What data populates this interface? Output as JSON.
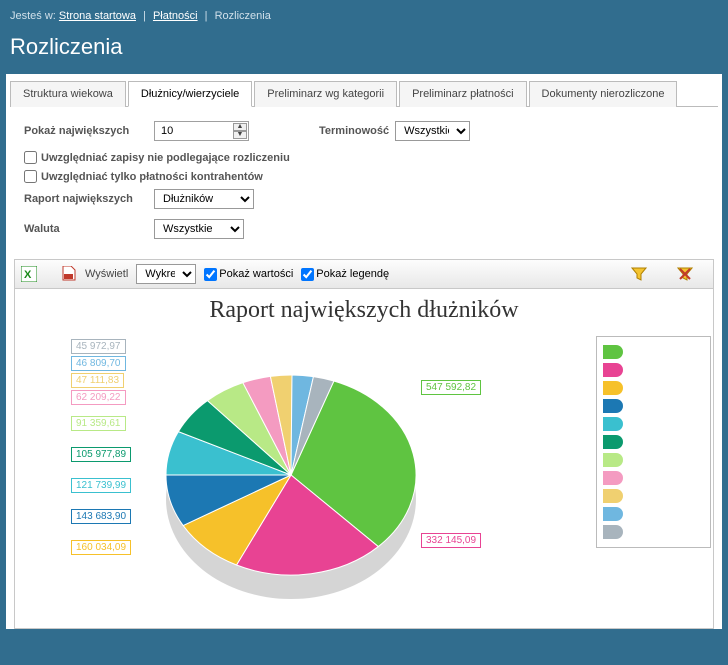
{
  "breadcrumb": {
    "prefix": "Jesteś w:",
    "items": [
      "Strona startowa",
      "Płatności",
      "Rozliczenia"
    ]
  },
  "page_title": "Rozliczenia",
  "tabs": [
    {
      "label": "Struktura wiekowa",
      "active": false
    },
    {
      "label": "Dłużnicy/wierzyciele",
      "active": true
    },
    {
      "label": "Preliminarz wg kategorii",
      "active": false
    },
    {
      "label": "Preliminarz płatności",
      "active": false
    },
    {
      "label": "Dokumenty nierozliczone",
      "active": false
    }
  ],
  "filters": {
    "pokaz_label": "Pokaż największych",
    "pokaz_value": "10",
    "terminowosc_label": "Terminowość",
    "terminowosc_value": "Wszystkie",
    "chk1_label": "Uwzględniać zapisy nie podlegające rozliczeniu",
    "chk1_checked": false,
    "chk2_label": "Uwzględniać tylko płatności kontrahentów",
    "chk2_checked": false,
    "raport_label": "Raport największych",
    "raport_value": "Dłużników",
    "waluta_label": "Waluta",
    "waluta_value": "Wszystkie"
  },
  "toolbar": {
    "wyswietl_label": "Wyświetl",
    "wyswietl_value": "Wykres",
    "pokaz_wartosci": "Pokaż wartości",
    "pokaz_legende": "Pokaż legendę"
  },
  "chart_data": {
    "type": "pie",
    "title": "Raport największych dłużników",
    "series": [
      {
        "label": "547 592,82",
        "value": 547592.82,
        "color": "#5fc441"
      },
      {
        "label": "332 145,09",
        "value": 332145.09,
        "color": "#e84393"
      },
      {
        "label": "160 034,09",
        "value": 160034.09,
        "color": "#f6c12a"
      },
      {
        "label": "143 683,90",
        "value": 143683.9,
        "color": "#1c78b3"
      },
      {
        "label": "121 739,99",
        "value": 121739.99,
        "color": "#3ac0cf"
      },
      {
        "label": "105 977,89",
        "value": 105977.89,
        "color": "#0b9a6e"
      },
      {
        "label": "91 359,61",
        "value": 91359.61,
        "color": "#b8e986"
      },
      {
        "label": "62 209,22",
        "value": 62209.22,
        "color": "#f49bc1"
      },
      {
        "label": "47 111,83",
        "value": 47111.83,
        "color": "#f0d070"
      },
      {
        "label": "46 809,70",
        "value": 46809.7,
        "color": "#6fb7e0"
      },
      {
        "label": "45 972,97",
        "value": 45972.97,
        "color": "#a8b4bd"
      }
    ],
    "legend_position": "right"
  }
}
